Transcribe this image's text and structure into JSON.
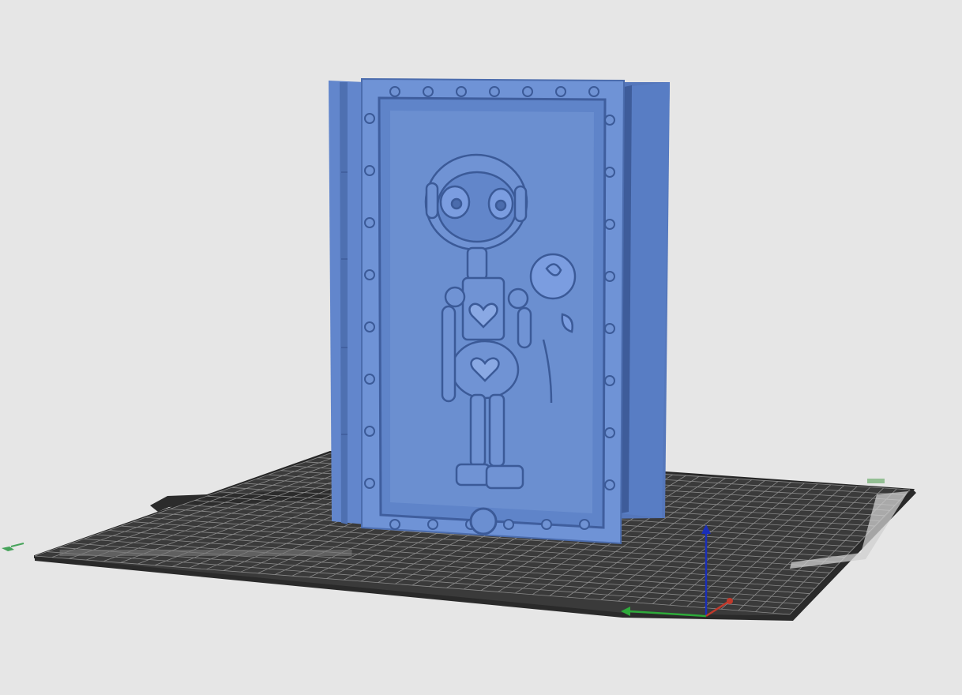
{
  "app": {
    "view": "3d-viewport"
  },
  "bed": {
    "color": "#3a3a3a",
    "grid_color": "#8a8a8a",
    "edge_color": "#2a2a2a"
  },
  "model": {
    "color": "#5b82c8",
    "shade_dark": "#3f5f9c",
    "shade_light": "#7fa2dc"
  },
  "axes": {
    "x_color": "#c0392b",
    "y_color": "#2eaa3a",
    "z_color": "#1a2fb8"
  },
  "icons": [
    "axis-gizmo-icon",
    "bed-logo-icon"
  ]
}
